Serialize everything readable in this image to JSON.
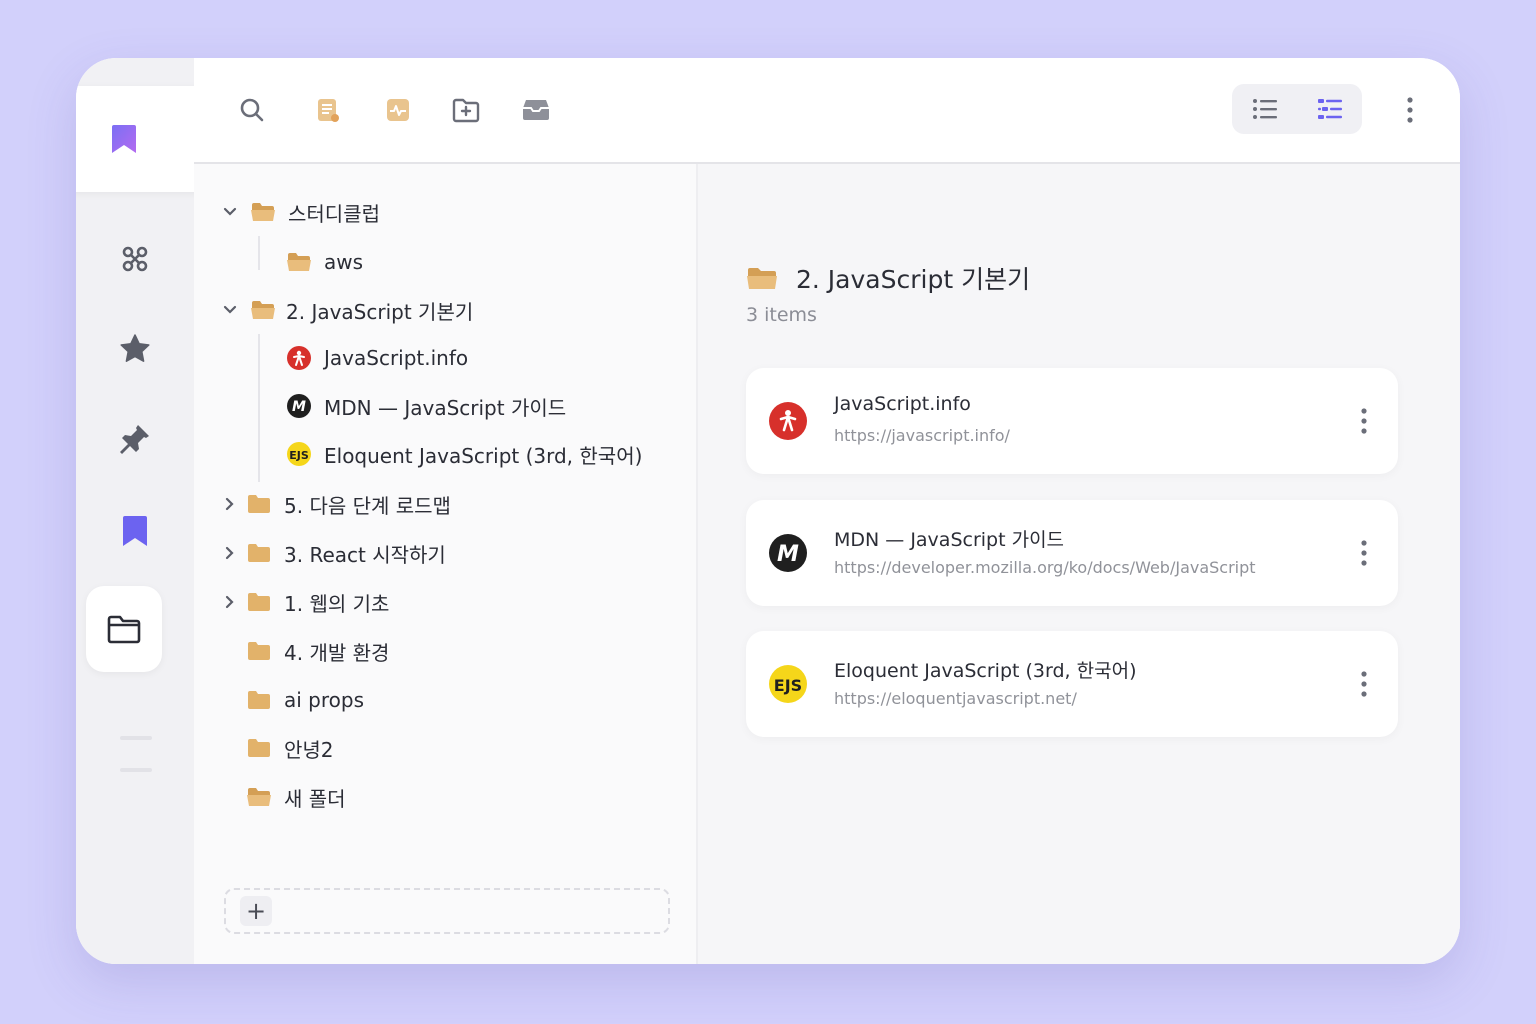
{
  "toolbar": {
    "tools": [
      "search-icon",
      "notes-icon",
      "activity-icon",
      "new-folder-icon",
      "archive-icon"
    ],
    "view_modes": [
      "list-view-icon",
      "detail-view-icon"
    ],
    "active_view": "detail-view-icon"
  },
  "rail": {
    "items": [
      "bookmark-app-icon",
      "shortcuts-icon",
      "star-icon",
      "pin-icon",
      "bookmark-icon",
      "folder-icon"
    ],
    "active": "folder-icon"
  },
  "tree": {
    "items": [
      {
        "label": "스터디클럽"
      },
      {
        "label": "aws"
      },
      {
        "label": "2. JavaScript 기본기"
      },
      {
        "label": "JavaScript.info"
      },
      {
        "label": "MDN — JavaScript 가이드"
      },
      {
        "label": "Eloquent JavaScript (3rd, 한국어)"
      },
      {
        "label": "5. 다음 단계 로드맵"
      },
      {
        "label": "3. React 시작하기"
      },
      {
        "label": "1. 웹의 기초"
      },
      {
        "label": "4. 개발 환경"
      },
      {
        "label": "ai props"
      },
      {
        "label": "안녕2"
      },
      {
        "label": "새 폴더"
      }
    ],
    "add_label": "+"
  },
  "detail": {
    "title": "2. JavaScript 기본기",
    "count": "3 items",
    "bookmarks": [
      {
        "title": "JavaScript.info",
        "url": "https://javascript.info/"
      },
      {
        "title": "MDN — JavaScript 가이드",
        "url": "https://developer.mozilla.org/ko/docs/Web/JavaScript"
      },
      {
        "title": "Eloquent JavaScript (3rd, 한국어)",
        "url": "https://eloquentjavascript.net/"
      }
    ]
  },
  "favicons": {
    "javascript_info": {
      "mark": "🚶",
      "bg": "#d7302b"
    },
    "mdn": {
      "mark": "M",
      "bg": "#1f1f1f"
    },
    "eloquent": {
      "mark": "EJS",
      "bg": "#f5d61a"
    }
  },
  "colors": {
    "accent": "#6c63f0",
    "folder": "#dcae6a",
    "background": "#d2d0fb"
  }
}
